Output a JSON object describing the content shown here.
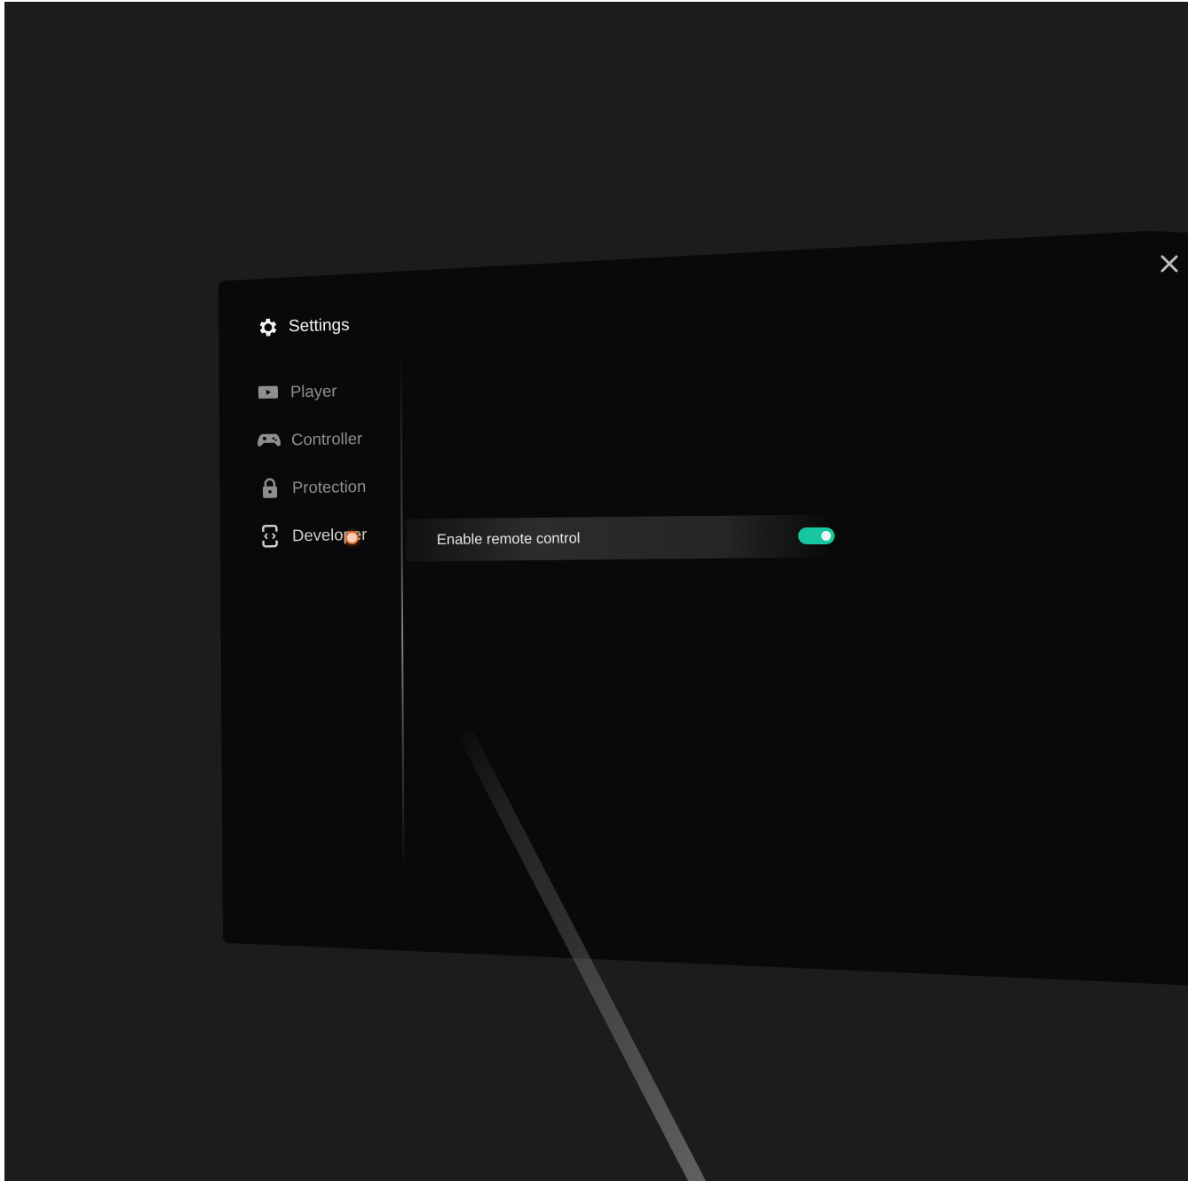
{
  "app": {
    "title": "Settings",
    "accent_color": "#18c6a1",
    "pointer_color": "#e96a2b"
  },
  "sidebar": {
    "items": [
      {
        "label": "Player",
        "icon": "video-icon",
        "active": false
      },
      {
        "label": "Controller",
        "icon": "gamepad-icon",
        "active": false
      },
      {
        "label": "Protection",
        "icon": "lock-icon",
        "active": false
      },
      {
        "label": "Developer",
        "icon": "developer-icon",
        "active": true
      }
    ]
  },
  "main": {
    "settings": [
      {
        "label": "Enable remote control",
        "enabled": true
      }
    ]
  },
  "window": {
    "close_icon": "close-icon"
  }
}
